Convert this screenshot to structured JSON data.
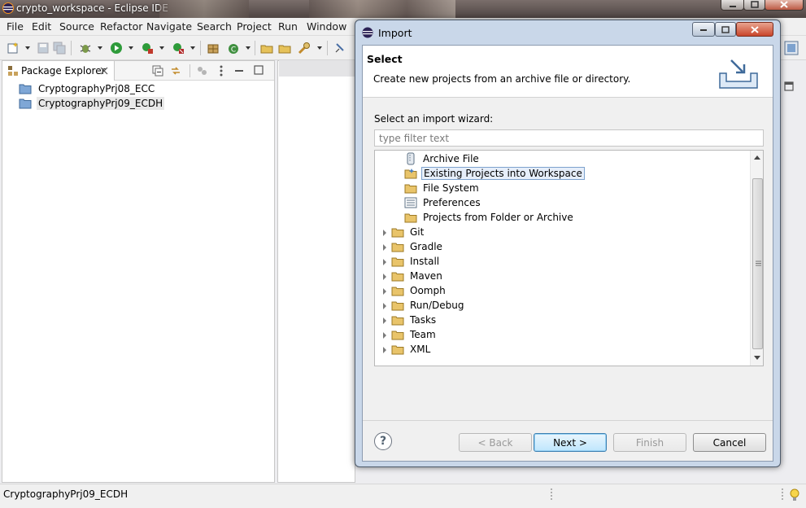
{
  "window": {
    "title": "crypto_workspace - Eclipse IDE"
  },
  "menu": [
    "File",
    "Edit",
    "Source",
    "Refactor",
    "Navigate",
    "Search",
    "Project",
    "Run",
    "Window"
  ],
  "package_explorer": {
    "tab_label": "Package Explorer",
    "projects": [
      {
        "label": "CryptographyPrj08_ECC",
        "selected": false
      },
      {
        "label": "CryptographyPrj09_ECDH",
        "selected": true
      }
    ]
  },
  "status_bar": {
    "text": "CryptographyPrj09_ECDH"
  },
  "import_dialog": {
    "title": "Import",
    "heading": "Select",
    "description": "Create new projects from an archive file or directory.",
    "wizard_label": "Select an import wizard:",
    "filter_placeholder": "type filter text",
    "filter_value": "",
    "general_children": [
      {
        "label": "Archive File",
        "icon": "archive-icon",
        "selected": false
      },
      {
        "label": "Existing Projects into Workspace",
        "icon": "project-folder-icon",
        "selected": true
      },
      {
        "label": "File System",
        "icon": "folder-icon",
        "selected": false
      },
      {
        "label": "Preferences",
        "icon": "preferences-icon",
        "selected": false
      },
      {
        "label": "Projects from Folder or Archive",
        "icon": "folder-icon",
        "selected": false
      }
    ],
    "categories": [
      "Git",
      "Gradle",
      "Install",
      "Maven",
      "Oomph",
      "Run/Debug",
      "Tasks",
      "Team",
      "XML"
    ],
    "buttons": {
      "back": "< Back",
      "next": "Next >",
      "finish": "Finish",
      "cancel": "Cancel"
    },
    "help_symbol": "?"
  },
  "colors": {
    "dialog_frame": "#c9d7e9",
    "selection_border": "#7da2ce",
    "folder_yellow": "#e9c46a",
    "title_bar": "#5a4f4c"
  }
}
